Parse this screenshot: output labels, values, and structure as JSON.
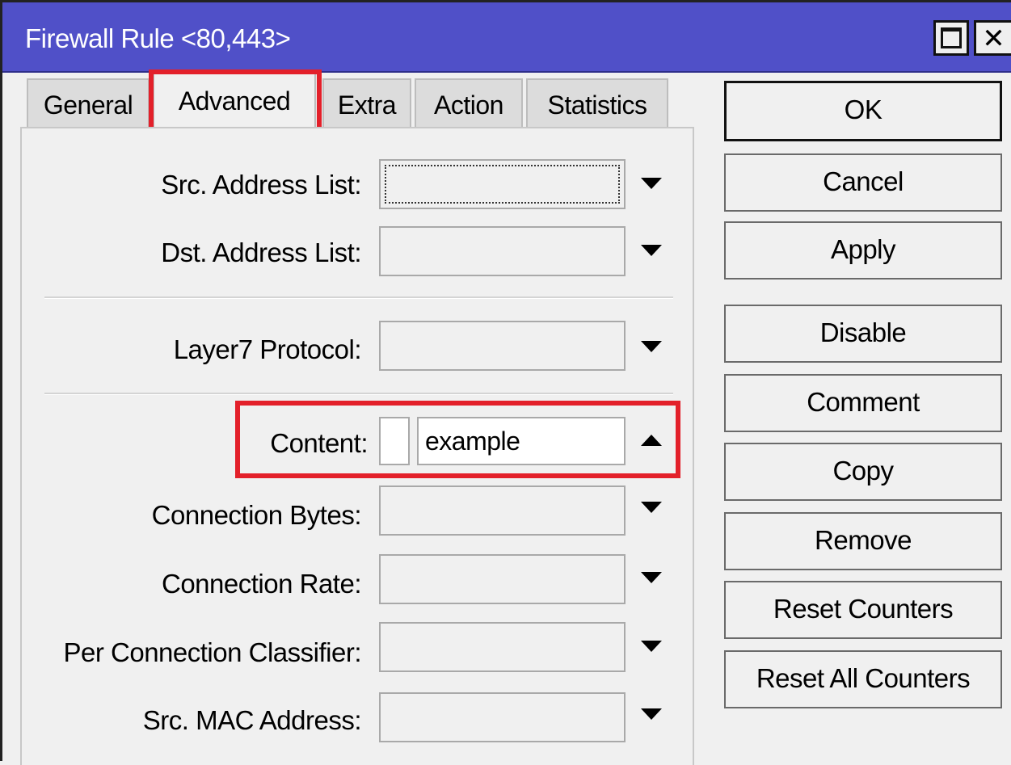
{
  "window": {
    "title": "Firewall Rule <80,443>"
  },
  "tabs": [
    {
      "label": "General"
    },
    {
      "label": "Advanced"
    },
    {
      "label": "Extra"
    },
    {
      "label": "Action"
    },
    {
      "label": "Statistics"
    }
  ],
  "active_tab": "Advanced",
  "fields": {
    "src_address_list": {
      "label": "Src. Address List:",
      "value": ""
    },
    "dst_address_list": {
      "label": "Dst. Address List:",
      "value": ""
    },
    "layer7_protocol": {
      "label": "Layer7 Protocol:",
      "value": ""
    },
    "content": {
      "label": "Content:",
      "value": "example",
      "negate_checked": false
    },
    "connection_bytes": {
      "label": "Connection Bytes:",
      "value": ""
    },
    "connection_rate": {
      "label": "Connection Rate:",
      "value": ""
    },
    "per_connection_classifier": {
      "label": "Per Connection Classifier:",
      "value": ""
    },
    "src_mac_address": {
      "label": "Src. MAC Address:",
      "value": ""
    }
  },
  "buttons": {
    "ok": "OK",
    "cancel": "Cancel",
    "apply": "Apply",
    "disable": "Disable",
    "comment": "Comment",
    "copy": "Copy",
    "remove": "Remove",
    "reset_counters": "Reset Counters",
    "reset_all_counters": "Reset All Counters"
  },
  "colors": {
    "titlebar": "#5050c8",
    "highlight": "#e3202a"
  },
  "icons": {
    "dropdown": "triangle-down",
    "collapse": "triangle-up",
    "maximize": "square",
    "close": "x"
  }
}
